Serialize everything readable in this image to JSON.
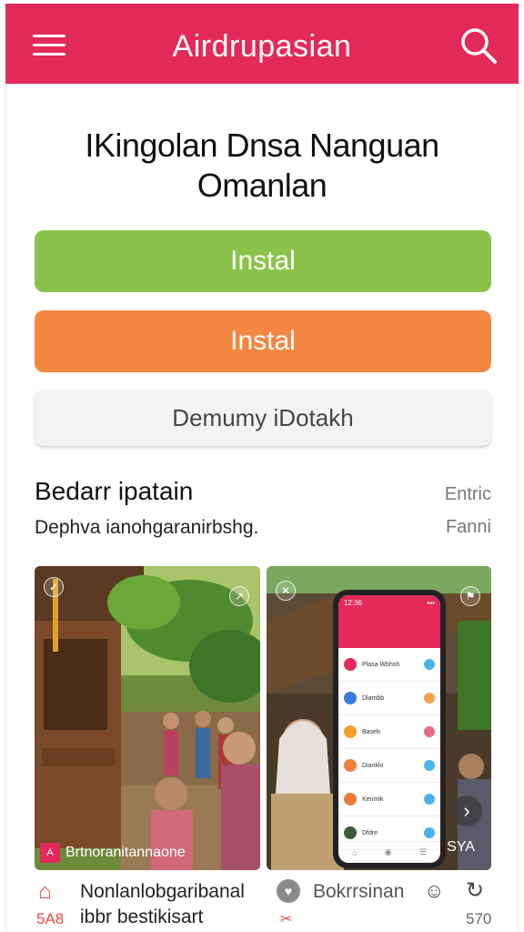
{
  "header": {
    "title": "Airdrupasian",
    "menu_icon": "menu-icon",
    "search_icon": "search-icon",
    "color": "#e32a5a"
  },
  "main": {
    "headline_line1": "IKingolan Dnsa Nanguan",
    "headline_line2": "Omanlan",
    "buttons": [
      {
        "label": "Instal",
        "color": "#8bc34a"
      },
      {
        "label": "Instal",
        "color": "#f58642"
      },
      {
        "label": "Demumy iDotakh",
        "color": "#f3f3f3"
      }
    ]
  },
  "section": {
    "title": "Bedarr ipatain",
    "link": "Entric",
    "subtitle": "Dephva ianohgaranirbshg.",
    "link2": "Fanni"
  },
  "gallery": [
    {
      "caption": "Brtnoranitannaone",
      "icon": "app-logo-icon",
      "corner": "leaf-icon"
    },
    {
      "tag": "SYA",
      "corner": "close-icon",
      "corner2": "flag-icon",
      "next_icon": "chevron-right-icon",
      "phone": {
        "status": "12:36",
        "rows": [
          "Plasa Wbhsh",
          "Dlambb",
          "Baseb",
          "Dianklo",
          "Kenmik",
          "Dfdre"
        ]
      }
    }
  ],
  "footer": {
    "item1": {
      "icon": "home-icon",
      "count": "5A8",
      "title": "Nonlanlobgaribanal",
      "subtitle": "ibbr bestikisart"
    },
    "item2": {
      "icon": "heart-icon",
      "icon2": "shuffle-icon",
      "title": "Bokrrsinan"
    },
    "item3": {
      "icon": "chat-icon",
      "icon2": "refresh-icon",
      "count": "570"
    }
  }
}
